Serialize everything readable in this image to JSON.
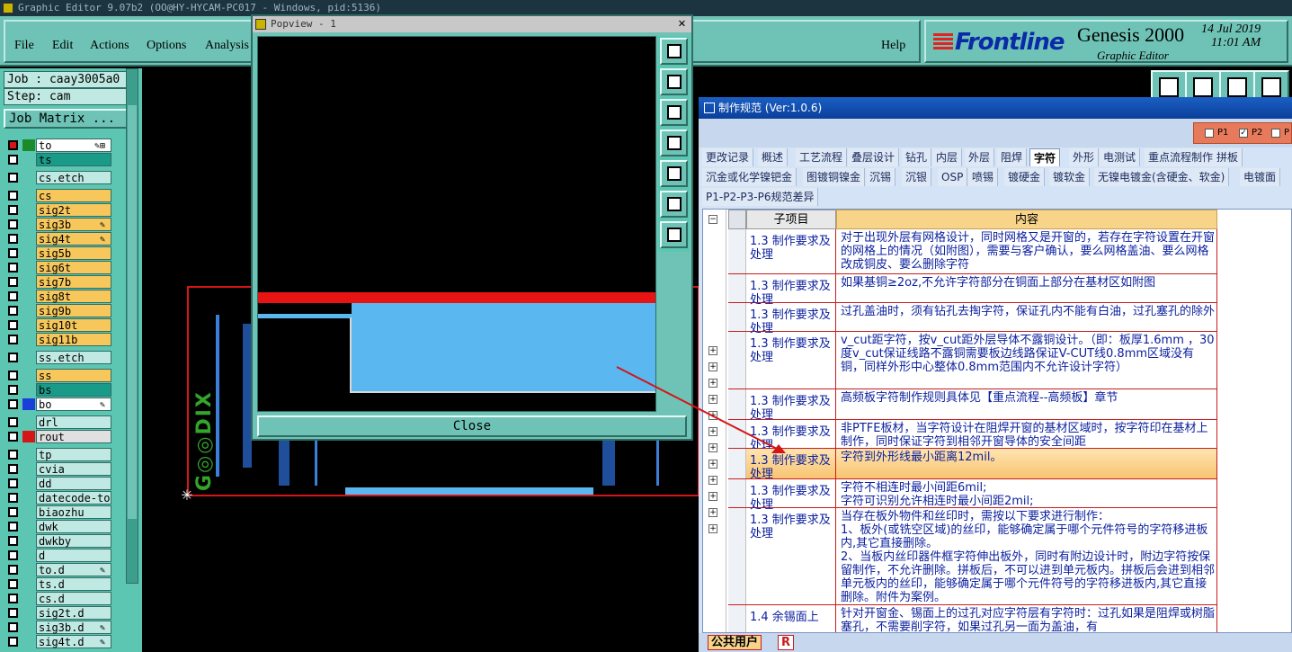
{
  "window": {
    "title": "Graphic Editor 9.07b2 (OO@HY-HYCAM-PC017 - Windows, pid:5136)"
  },
  "menu": {
    "items": [
      "File",
      "Edit",
      "Actions",
      "Options",
      "Analysis"
    ],
    "help": "Help"
  },
  "brand": {
    "logo": "Frontline",
    "product": "Genesis 2000",
    "subtitle": "Graphic Editor",
    "date": "14 Jul 2019",
    "time": "11:01 AM"
  },
  "job": {
    "job": "Job : caay3005a0",
    "step": "Step: cam",
    "matrix_button": "Job Matrix ..."
  },
  "layers": [
    {
      "name": "to",
      "color": "#ffffff",
      "swatch": "#d41616",
      "swatch2": "#1a8a2a",
      "mark": "✎⊞"
    },
    {
      "name": "ts",
      "color": "#1a9a88"
    },
    {
      "name": "cs.etch",
      "color": "#bfe9e2"
    },
    {
      "name": "cs",
      "color": "#f7c75b"
    },
    {
      "name": "sig2t",
      "color": "#f7c75b"
    },
    {
      "name": "sig3b",
      "color": "#f7c75b",
      "mark": "✎"
    },
    {
      "name": "sig4t",
      "color": "#f7c75b",
      "mark": "✎"
    },
    {
      "name": "sig5b",
      "color": "#f7c75b"
    },
    {
      "name": "sig6t",
      "color": "#f7c75b"
    },
    {
      "name": "sig7b",
      "color": "#f7c75b"
    },
    {
      "name": "sig8t",
      "color": "#f7c75b"
    },
    {
      "name": "sig9b",
      "color": "#f7c75b"
    },
    {
      "name": "sig10t",
      "color": "#f7c75b"
    },
    {
      "name": "sig11b",
      "color": "#f7c75b"
    },
    {
      "name": "ss.etch",
      "color": "#bfe9e2"
    },
    {
      "name": "ss",
      "color": "#f7c75b"
    },
    {
      "name": "bs",
      "color": "#1a9a88"
    },
    {
      "name": "bo",
      "color": "#ffffff",
      "swatch2": "#1a3fd8",
      "mark": "✎"
    },
    {
      "name": "drl",
      "color": "#bfe9e2"
    },
    {
      "name": "rout",
      "color": "#e0e0e0",
      "swatch2": "#d41616"
    },
    {
      "name": "tp",
      "color": "#bfe9e2"
    },
    {
      "name": "cvia",
      "color": "#bfe9e2"
    },
    {
      "name": "dd",
      "color": "#bfe9e2"
    },
    {
      "name": "datecode-to",
      "color": "#bfe9e2"
    },
    {
      "name": "biaozhu",
      "color": "#bfe9e2"
    },
    {
      "name": "dwk",
      "color": "#bfe9e2"
    },
    {
      "name": "dwkby",
      "color": "#bfe9e2"
    },
    {
      "name": "d",
      "color": "#bfe9e2"
    },
    {
      "name": "to.d",
      "color": "#bfe9e2",
      "mark": "✎"
    },
    {
      "name": "ts.d",
      "color": "#bfe9e2"
    },
    {
      "name": "cs.d",
      "color": "#bfe9e2"
    },
    {
      "name": "sig2t.d",
      "color": "#bfe9e2"
    },
    {
      "name": "sig3b.d",
      "color": "#bfe9e2",
      "mark": "✎"
    },
    {
      "name": "sig4t.d",
      "color": "#bfe9e2",
      "mark": "✎"
    }
  ],
  "popview": {
    "title": "Popview - 1",
    "close": "Close"
  },
  "spec": {
    "title": "制作规范 (Ver:1.0.6)",
    "p_options": [
      "P1",
      "P2",
      "P"
    ],
    "tabs_row1": [
      "更改记录",
      "概述",
      "工艺流程",
      "叠层设计",
      "钻孔",
      "内层",
      "外层",
      "阻焊",
      "字符",
      "外形",
      "电测试",
      "重点流程制作",
      "拼板"
    ],
    "active_tab": "字符",
    "tabs_row2": [
      "沉金或化学镍钯金",
      "图镀铜镍金",
      "沉锡",
      "沉银",
      "OSP",
      "喷锡",
      "镀硬金",
      "镀软金",
      "无镍电镀金(含硬金、软金)",
      "电镀面"
    ],
    "tabs_row3": [
      "P1-P2-P3-P6规范差异"
    ],
    "col_sub": "子项目",
    "col_content": "内容",
    "rows": [
      {
        "sub": "1.3 制作要求及处理",
        "content": "对于出现外层有网格设计，同时网格又是开窗的，若存在字符设置在开窗的网格上的情况（如附图），需要与客户确认，要么网格盖油、要么网格改成铜皮、要么删除字符"
      },
      {
        "sub": "1.3 制作要求及处理",
        "content": "如果基铜≥2oz,不允许字符部分在铜面上部分在基材区如附图"
      },
      {
        "sub": "1.3 制作要求及处理",
        "content": "过孔盖油时，须有钻孔去掏字符，保证孔内不能有白油，过孔塞孔的除外"
      },
      {
        "sub": "1.3 制作要求及处理",
        "content": "v_cut距字符，按v_cut距外层导体不露铜设计。（即：板厚1.6mm ，30度v_cut保证线路不露铜需要板边线路保证V-CUT线0.8mm区域没有铜，同样外形中心整体0.8mm范围内不允许设计字符）"
      },
      {
        "sub": "1.3 制作要求及处理",
        "content": "高频板字符制作规则具体见【重点流程--高频板】章节"
      },
      {
        "sub": "1.3 制作要求及处理",
        "content": "非PTFE板材，当字符设计在阻焊开窗的基材区域时，按字符印在基材上制作，同时保证字符到相邻开窗导体的安全间距"
      },
      {
        "sub": "1.3 制作要求及处理",
        "content": "字符到外形线最小距离12mil。"
      },
      {
        "sub": "1.3 制作要求及处理",
        "content": "字符不相连时最小间距6mil;\n字符可识别允许相连时最小间距2mil;"
      },
      {
        "sub": "1.3 制作要求及处理",
        "content": "当存在板外物件和丝印时，需按以下要求进行制作：\n1、板外(或铣空区域)的丝印，能够确定属于哪个元件符号的字符移进板内,其它直接删除。\n2、当板内丝印器件框字符伸出板外，同时有附边设计时，附边字符按保留制作，不允许删除。拼板后，不可以进到单元板内。拼板后会进到相邻单元板内的丝印，能够确定属于哪个元件符号的字符移进板内,其它直接删除。附件为案例。"
      },
      {
        "sub": "1.4 余锡面上",
        "content": "针对开窗金、锡面上的过孔对应字符层有字符时：过孔如果是阻焊或树脂塞孔，不需要削字符，如果过孔另一面为盖油，有"
      }
    ],
    "user": "公共用户",
    "r": "R"
  }
}
